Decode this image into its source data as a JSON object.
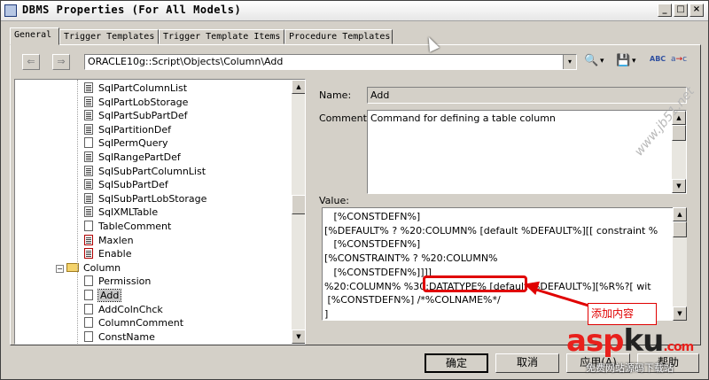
{
  "window": {
    "title": "DBMS Properties (For All Models)",
    "min_glyph": "_",
    "max_glyph": "□",
    "close_glyph": "×"
  },
  "tabs": [
    {
      "label": "General",
      "active": true
    },
    {
      "label": "Trigger Templates",
      "active": false
    },
    {
      "label": "Trigger Template Items",
      "active": false
    },
    {
      "label": "Procedure Templates",
      "active": false
    }
  ],
  "toolbar": {
    "back_glyph": "⇐",
    "forward_glyph": "⇒",
    "path": "ORACLE10g::Script\\Objects\\Column\\Add",
    "find_glyph": "🔍",
    "save_glyph": "💾",
    "dropdown_glyph": "▾",
    "spell_label": "ABC"
  },
  "tree": {
    "items": [
      {
        "label": "SqlPartColumnList",
        "icon": "text",
        "depth": 2
      },
      {
        "label": "SqlPartLobStorage",
        "icon": "text",
        "depth": 2
      },
      {
        "label": "SqlPartSubPartDef",
        "icon": "text",
        "depth": 2
      },
      {
        "label": "SqlPartitionDef",
        "icon": "text",
        "depth": 2
      },
      {
        "label": "SqlPermQuery",
        "icon": "blank",
        "depth": 2
      },
      {
        "label": "SqlRangePartDef",
        "icon": "text",
        "depth": 2
      },
      {
        "label": "SqlSubPartColumnList",
        "icon": "text",
        "depth": 2
      },
      {
        "label": "SqlSubPartDef",
        "icon": "text",
        "depth": 2
      },
      {
        "label": "SqlSubPartLobStorage",
        "icon": "text",
        "depth": 2
      },
      {
        "label": "SqlXMLTable",
        "icon": "text",
        "depth": 2
      },
      {
        "label": "TableComment",
        "icon": "blank",
        "depth": 2
      },
      {
        "label": "Maxlen",
        "icon": "red",
        "depth": 2
      },
      {
        "label": "Enable",
        "icon": "red",
        "depth": 2
      },
      {
        "label": "Column",
        "icon": "folder",
        "depth": 1
      },
      {
        "label": "Permission",
        "icon": "blank",
        "depth": 2
      },
      {
        "label": "Add",
        "icon": "blank",
        "depth": 2,
        "selected": true
      },
      {
        "label": "AddColnChck",
        "icon": "blank",
        "depth": 2
      },
      {
        "label": "ColumnComment",
        "icon": "blank",
        "depth": 2
      },
      {
        "label": "ConstName",
        "icon": "blank",
        "depth": 2
      }
    ]
  },
  "details": {
    "name_label": "Name:",
    "name_value": "Add",
    "comment_label": "Comment:",
    "comment_value": "Command for defining a table column",
    "value_label": "Value:",
    "code_lines": [
      "   [%CONSTDEFN%]",
      "[%DEFAULT% ? %20:COLUMN% [default %DEFAULT%][[ constraint %",
      "   [%CONSTDEFN%]",
      "[%CONSTRAINT% ? %20:COLUMN%",
      "   [%CONSTDEFN%]]]]",
      "%20:COLUMN% %30:DATATYPE% [default %DEFAULT%][%R%?[ wit",
      " [%CONSTDEFN%] /*%COLNAME%*/",
      "]"
    ]
  },
  "annotation": {
    "text": "添加内容"
  },
  "buttons": {
    "ok": "确定",
    "cancel": "取消",
    "apply": "应用(A)",
    "help": "帮助"
  },
  "watermark": {
    "asp": "asp",
    "ku": "ku",
    "suffix": ".com",
    "sub": "免费网站源码下载站",
    "jb": "www.jb51.net"
  }
}
